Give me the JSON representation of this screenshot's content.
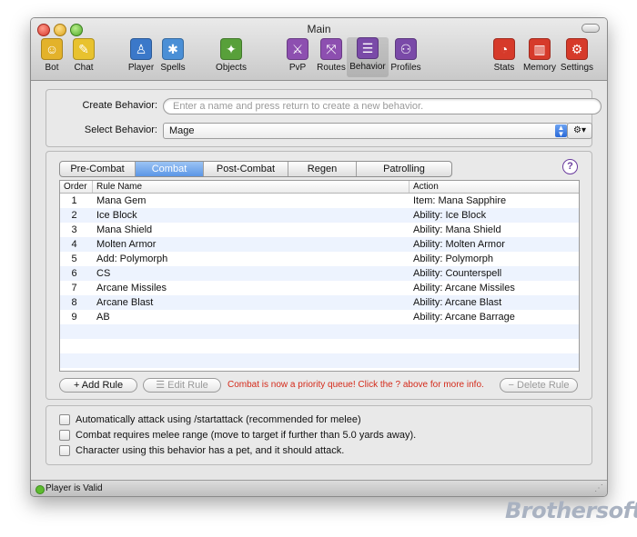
{
  "window": {
    "title": "Main"
  },
  "toolbar": {
    "left": [
      {
        "label": "Bot",
        "icon": "bot-icon",
        "color": "#e3b22a",
        "glyph": "☺"
      },
      {
        "label": "Chat",
        "icon": "chat-icon",
        "color": "#e8c22e",
        "glyph": "✎"
      }
    ],
    "middle": [
      {
        "label": "Player",
        "icon": "player-icon",
        "color": "#3b78c9",
        "glyph": "♙"
      },
      {
        "label": "Spells",
        "icon": "spells-icon",
        "color": "#4a8fd6",
        "glyph": "✱"
      },
      {
        "label": "Objects",
        "icon": "objects-icon",
        "color": "#58a03a",
        "glyph": "✦"
      },
      {
        "label": "PvP",
        "icon": "pvp-icon",
        "color": "#8d4fb0",
        "glyph": "⚔"
      },
      {
        "label": "Routes",
        "icon": "routes-icon",
        "color": "#8d4fb0",
        "glyph": "⤧"
      },
      {
        "label": "Behavior",
        "icon": "behavior-icon",
        "color": "#7a4aa8",
        "glyph": "☰"
      },
      {
        "label": "Profiles",
        "icon": "profiles-icon",
        "color": "#7a4aa8",
        "glyph": "⚇"
      }
    ],
    "right": [
      {
        "label": "Stats",
        "icon": "stats-icon",
        "color": "#d63a2a",
        "glyph": "◔"
      },
      {
        "label": "Memory",
        "icon": "memory-icon",
        "color": "#d63a2a",
        "glyph": "▥"
      },
      {
        "label": "Settings",
        "icon": "settings-icon",
        "color": "#d63a2a",
        "glyph": "⚙"
      }
    ]
  },
  "behavior_form": {
    "create_label": "Create Behavior:",
    "create_placeholder": "Enter a name and press return to create a new behavior.",
    "select_label": "Select Behavior:",
    "select_value": "Mage"
  },
  "tabs": [
    "Pre-Combat",
    "Combat",
    "Post-Combat",
    "Regen",
    "Patrolling"
  ],
  "active_tab": "Combat",
  "help_label": "?",
  "table": {
    "columns": [
      "Order",
      "Rule Name",
      "Action"
    ],
    "rows": [
      {
        "order": "1",
        "name": "Mana Gem",
        "action": "Item: Mana Sapphire"
      },
      {
        "order": "2",
        "name": "Ice Block",
        "action": "Ability: Ice Block"
      },
      {
        "order": "3",
        "name": "Mana Shield",
        "action": "Ability: Mana Shield"
      },
      {
        "order": "4",
        "name": "Molten Armor",
        "action": "Ability: Molten Armor"
      },
      {
        "order": "5",
        "name": "Add: Polymorph",
        "action": "Ability: Polymorph"
      },
      {
        "order": "6",
        "name": "CS",
        "action": "Ability: Counterspell"
      },
      {
        "order": "7",
        "name": "Arcane Missiles",
        "action": "Ability: Arcane Missiles"
      },
      {
        "order": "8",
        "name": "Arcane Blast",
        "action": "Ability: Arcane Blast"
      },
      {
        "order": "9",
        "name": "AB",
        "action": "Ability: Arcane Barrage"
      }
    ]
  },
  "rule_buttons": {
    "add": "+ Add Rule",
    "edit": "☰ Edit Rule",
    "delete": "− Delete Rule",
    "warning": "Combat is now a priority queue! Click the ? above for more info."
  },
  "options": [
    "Automatically attack using /startattack (recommended for melee)",
    "Combat requires melee range (move to target if further than 5.0 yards away).",
    "Character using this behavior has a pet, and it should attack."
  ],
  "status": "Player is Valid",
  "watermark": "Brothersoft"
}
